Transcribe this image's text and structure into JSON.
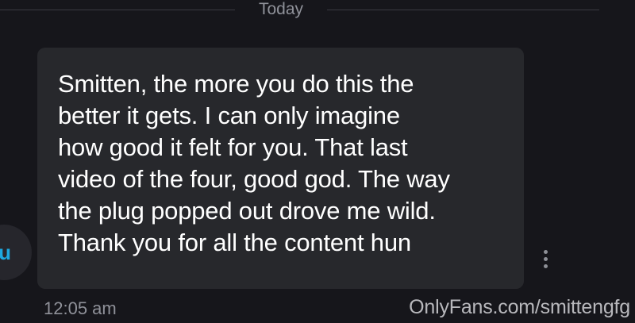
{
  "divider": {
    "label": "Today"
  },
  "avatar": {
    "initial": "u"
  },
  "message": {
    "text": "Smitten, the more you do this the\nbetter it gets. I can only imagine\nhow good it felt for you. That last\nvideo of the four, good god. The way\nthe plug popped out drove me wild.\nThank you for all the content hun",
    "timestamp": "12:05 am"
  },
  "watermark": {
    "text": "OnlyFans.com/smittengfg"
  },
  "icons": {
    "more": "more-vertical-icon"
  },
  "colors": {
    "background": "#16161b",
    "bubble": "#27282c",
    "accent": "#1ea8e0",
    "muted_text": "#8f9199"
  }
}
